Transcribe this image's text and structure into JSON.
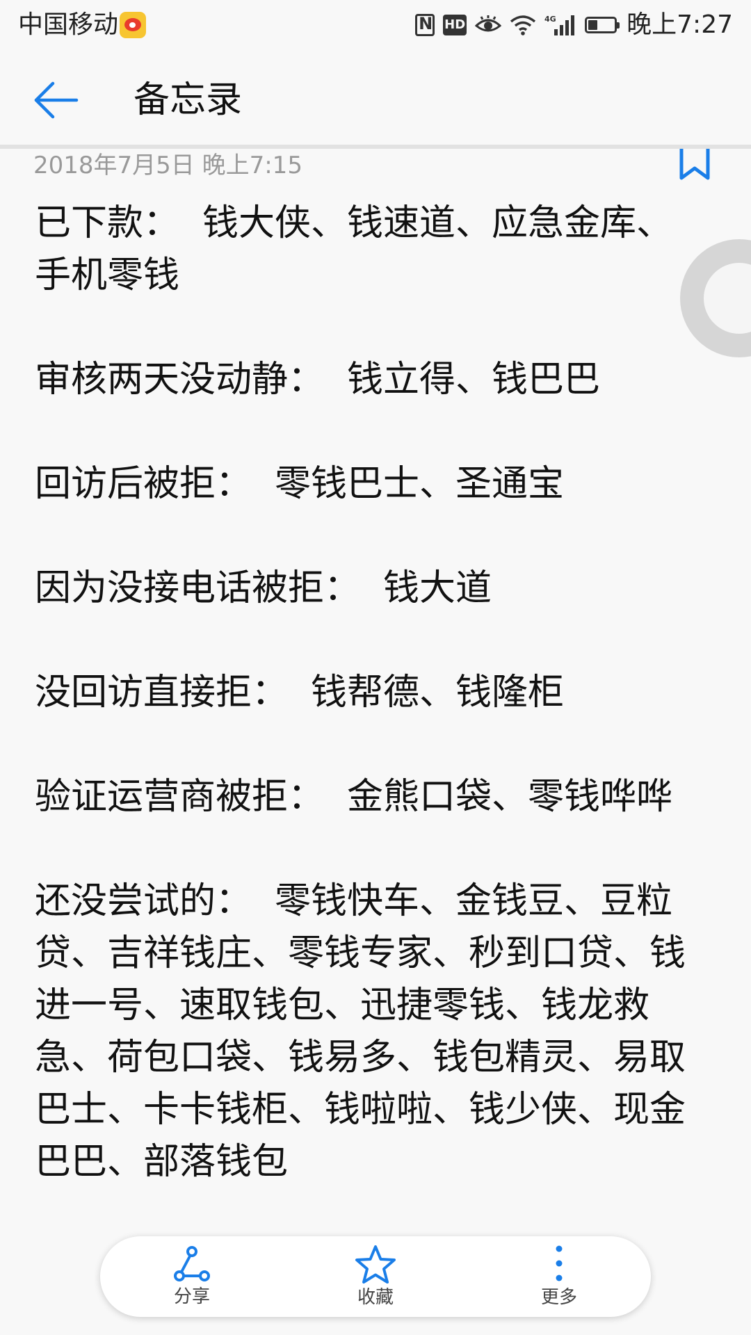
{
  "status_bar": {
    "carrier": "中国移动",
    "hd_label": "HD",
    "network": "4G",
    "battery_level": 0.35,
    "time": "晚上7:27"
  },
  "header": {
    "title": "备忘录"
  },
  "note": {
    "date": "2018年7月5日 晚上7:15",
    "paragraphs": [
      "已下款：  钱大侠、钱速道、应急金库、手机零钱",
      "审核两天没动静：  钱立得、钱巴巴",
      "回访后被拒：  零钱巴士、圣通宝",
      "因为没接电话被拒：  钱大道",
      "没回访直接拒：  钱帮德、钱隆柜",
      "验证运营商被拒：  金熊口袋、零钱哗哗",
      "还没尝试的：  零钱快车、金钱豆、豆粒贷、吉祥钱庄、零钱专家、秒到口贷、钱进一号、速取钱包、迅捷零钱、钱龙救急、荷包口袋、钱易多、钱包精灵、易取巴士、卡卡钱柜、钱啦啦、钱少侠、现金巴巴、部落钱包"
    ]
  },
  "actions": {
    "share_label": "分享",
    "favorite_label": "收藏",
    "more_label": "更多"
  },
  "colors": {
    "accent": "#1a7ee8",
    "text": "#111111",
    "date_text": "#999999",
    "background": "#f8f8f8"
  },
  "icons": {
    "back": "arrow-left-icon",
    "bookmark": "bookmark-icon",
    "share": "share-icon",
    "favorite": "star-icon",
    "more": "more-vertical-icon"
  }
}
